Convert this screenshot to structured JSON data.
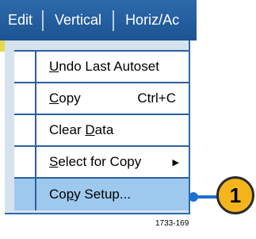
{
  "menubar": {
    "items": [
      {
        "label": "Edit"
      },
      {
        "label": "Vertical"
      },
      {
        "label": "Horiz/Ac"
      }
    ]
  },
  "edit_menu": {
    "items": [
      {
        "pre": "",
        "accel": "U",
        "post": "ndo Last Autoset",
        "shortcut": "",
        "submenu": false,
        "selected": false
      },
      {
        "pre": "",
        "accel": "C",
        "post": "opy",
        "shortcut": "Ctrl+C",
        "submenu": false,
        "selected": false
      },
      {
        "pre": "Clear ",
        "accel": "D",
        "post": "ata",
        "shortcut": "",
        "submenu": false,
        "selected": false
      },
      {
        "pre": "",
        "accel": "S",
        "post": "elect for Copy",
        "shortcut": "",
        "submenu": true,
        "selected": false
      },
      {
        "pre": "Co",
        "accel": "p",
        "post": "y Setup...",
        "shortcut": "",
        "submenu": false,
        "selected": true
      }
    ],
    "submenu_arrow": "▶"
  },
  "callout": {
    "number": "1",
    "color": "#f3b51b",
    "line_color": "#1f6fd0"
  },
  "figure_id": "1733-169",
  "colors": {
    "menubar": "#1d5392",
    "menu_background": "#d6e3ef",
    "selected_row": "#9ec9ef",
    "grid_lines": "#2a5fa0"
  }
}
